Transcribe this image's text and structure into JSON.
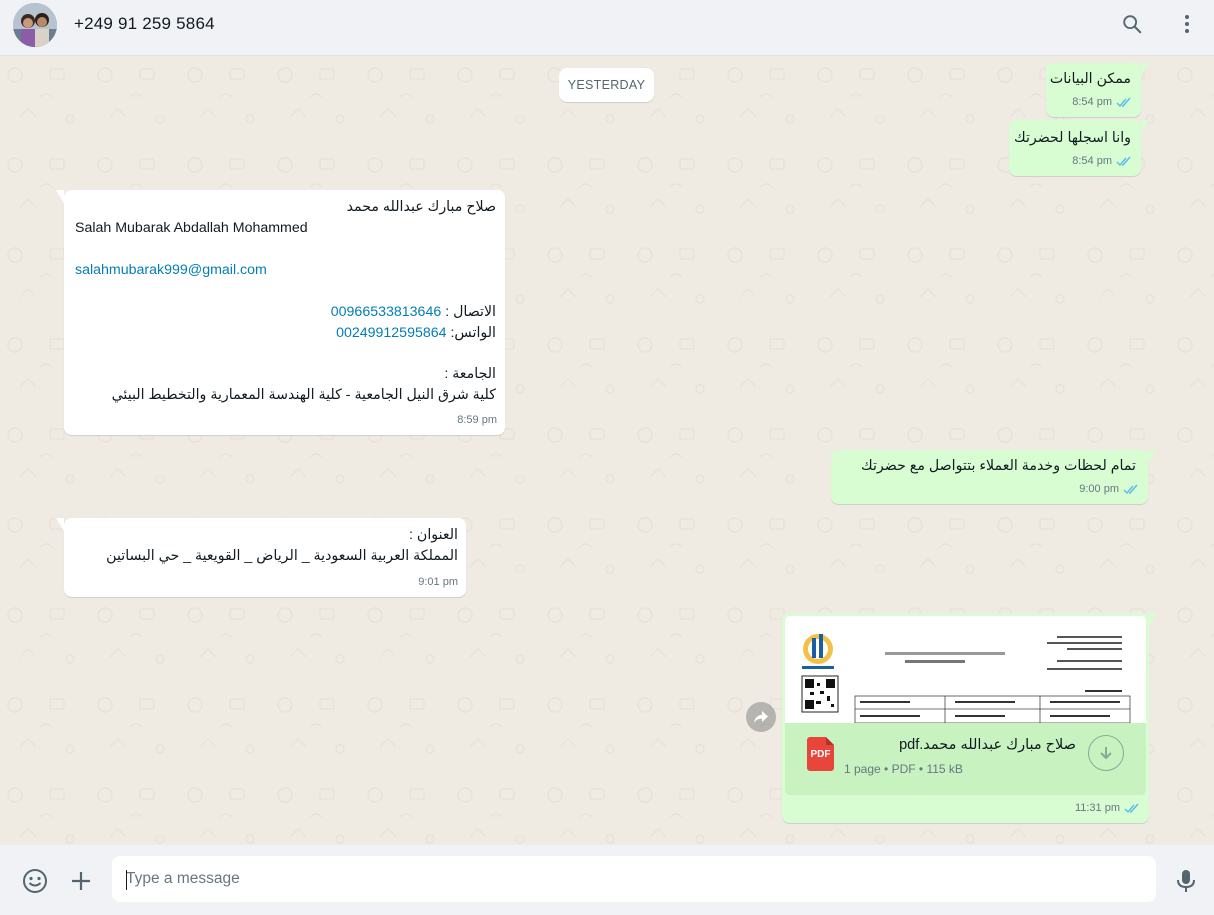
{
  "header": {
    "contact_name": "+249 91 259 5864",
    "icons": [
      "search-icon",
      "menu-dots-icon"
    ]
  },
  "chat": {
    "day_label": "YESTERDAY",
    "messages": [
      {
        "dir": "out",
        "text": "ممكن البيانات",
        "time": "8:54 pm",
        "status": "read"
      },
      {
        "dir": "out",
        "text": "وانا اسجلها لحضرتك",
        "time": "8:54 pm",
        "status": "read"
      },
      {
        "dir": "in",
        "name_ar": "صلاح مبارك عبدالله محمد",
        "name_en": "Salah Mubarak Abdallah Mohammed",
        "email": "salahmubarak999@gmail.com",
        "contact_label": "الاتصال :",
        "contact_number": "00966533813646",
        "whatsapp_label": "الواتس:",
        "whatsapp_number": "00249912595864",
        "university_label": "الجامعة :",
        "university": "كلية شرق النيل الجامعية - كلية الهندسة المعمارية والتخطيط البيئي",
        "time": "8:59 pm"
      },
      {
        "dir": "out",
        "text": "تمام لحظات وخدمة العملاء بتتواصل مع حضرتك",
        "time": "9:00 pm",
        "status": "read"
      },
      {
        "dir": "in",
        "label": "العنوان :",
        "text": "المملكة العربية السعودية _ الرياض _ القويعية _ حي البساتين",
        "time": "9:01 pm"
      },
      {
        "dir": "out",
        "type": "document",
        "file_name": "صلاح مبارك عبدالله محمد.pdf",
        "file_meta": "1 page • PDF • 115 kB",
        "file_badge": "PDF",
        "time": "11:31 pm",
        "status": "read"
      }
    ]
  },
  "footer": {
    "placeholder": "Type a message",
    "icons": [
      "emoji-icon",
      "attach-plus-icon",
      "microphone-icon"
    ]
  },
  "colors": {
    "outgoing_bubble": "#d9fdd3",
    "incoming_bubble": "#ffffff",
    "chat_bg": "#efeae2",
    "read_tick": "#53bdeb",
    "link": "#027eb5"
  }
}
